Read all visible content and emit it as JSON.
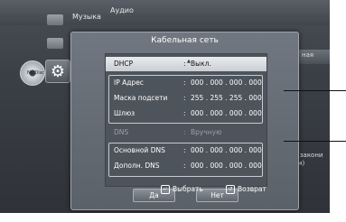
{
  "background_menu": {
    "categories": [
      {
        "label": "Музыка"
      },
      {
        "label": "Аудио"
      }
    ],
    "disc_label": "No Disc",
    "right_items": [
      {
        "label": "ная"
      },
      {
        "label": "но (закони"
      },
      {
        "label": "-лям)"
      }
    ]
  },
  "dialog": {
    "title": "Кабельная сеть",
    "rows": [
      {
        "label": "DHCP",
        "sep": ":",
        "value": "Выкл."
      },
      {
        "label": "IP Адрес",
        "sep": ":",
        "value": "000 . 000 . 000 . 000"
      },
      {
        "label": "Маска подсети",
        "sep": ":",
        "value": "255 . 255 . 255 . 000"
      },
      {
        "label": "Шлюз",
        "sep": ":",
        "value": "000 . 000 . 000 . 000"
      },
      {
        "label": "DNS",
        "sep": ":",
        "value": "Вручную"
      },
      {
        "label": "Основной DNS",
        "sep": ":",
        "value": "000 . 000 . 000 . 000"
      },
      {
        "label": "Дополн. DNS",
        "sep": ":",
        "value": "000 . 000 . 000 . 000"
      }
    ],
    "buttons": {
      "yes": "Да",
      "no": "Нет"
    },
    "hints": {
      "select": "Выбрать",
      "back": "Возврат"
    }
  }
}
